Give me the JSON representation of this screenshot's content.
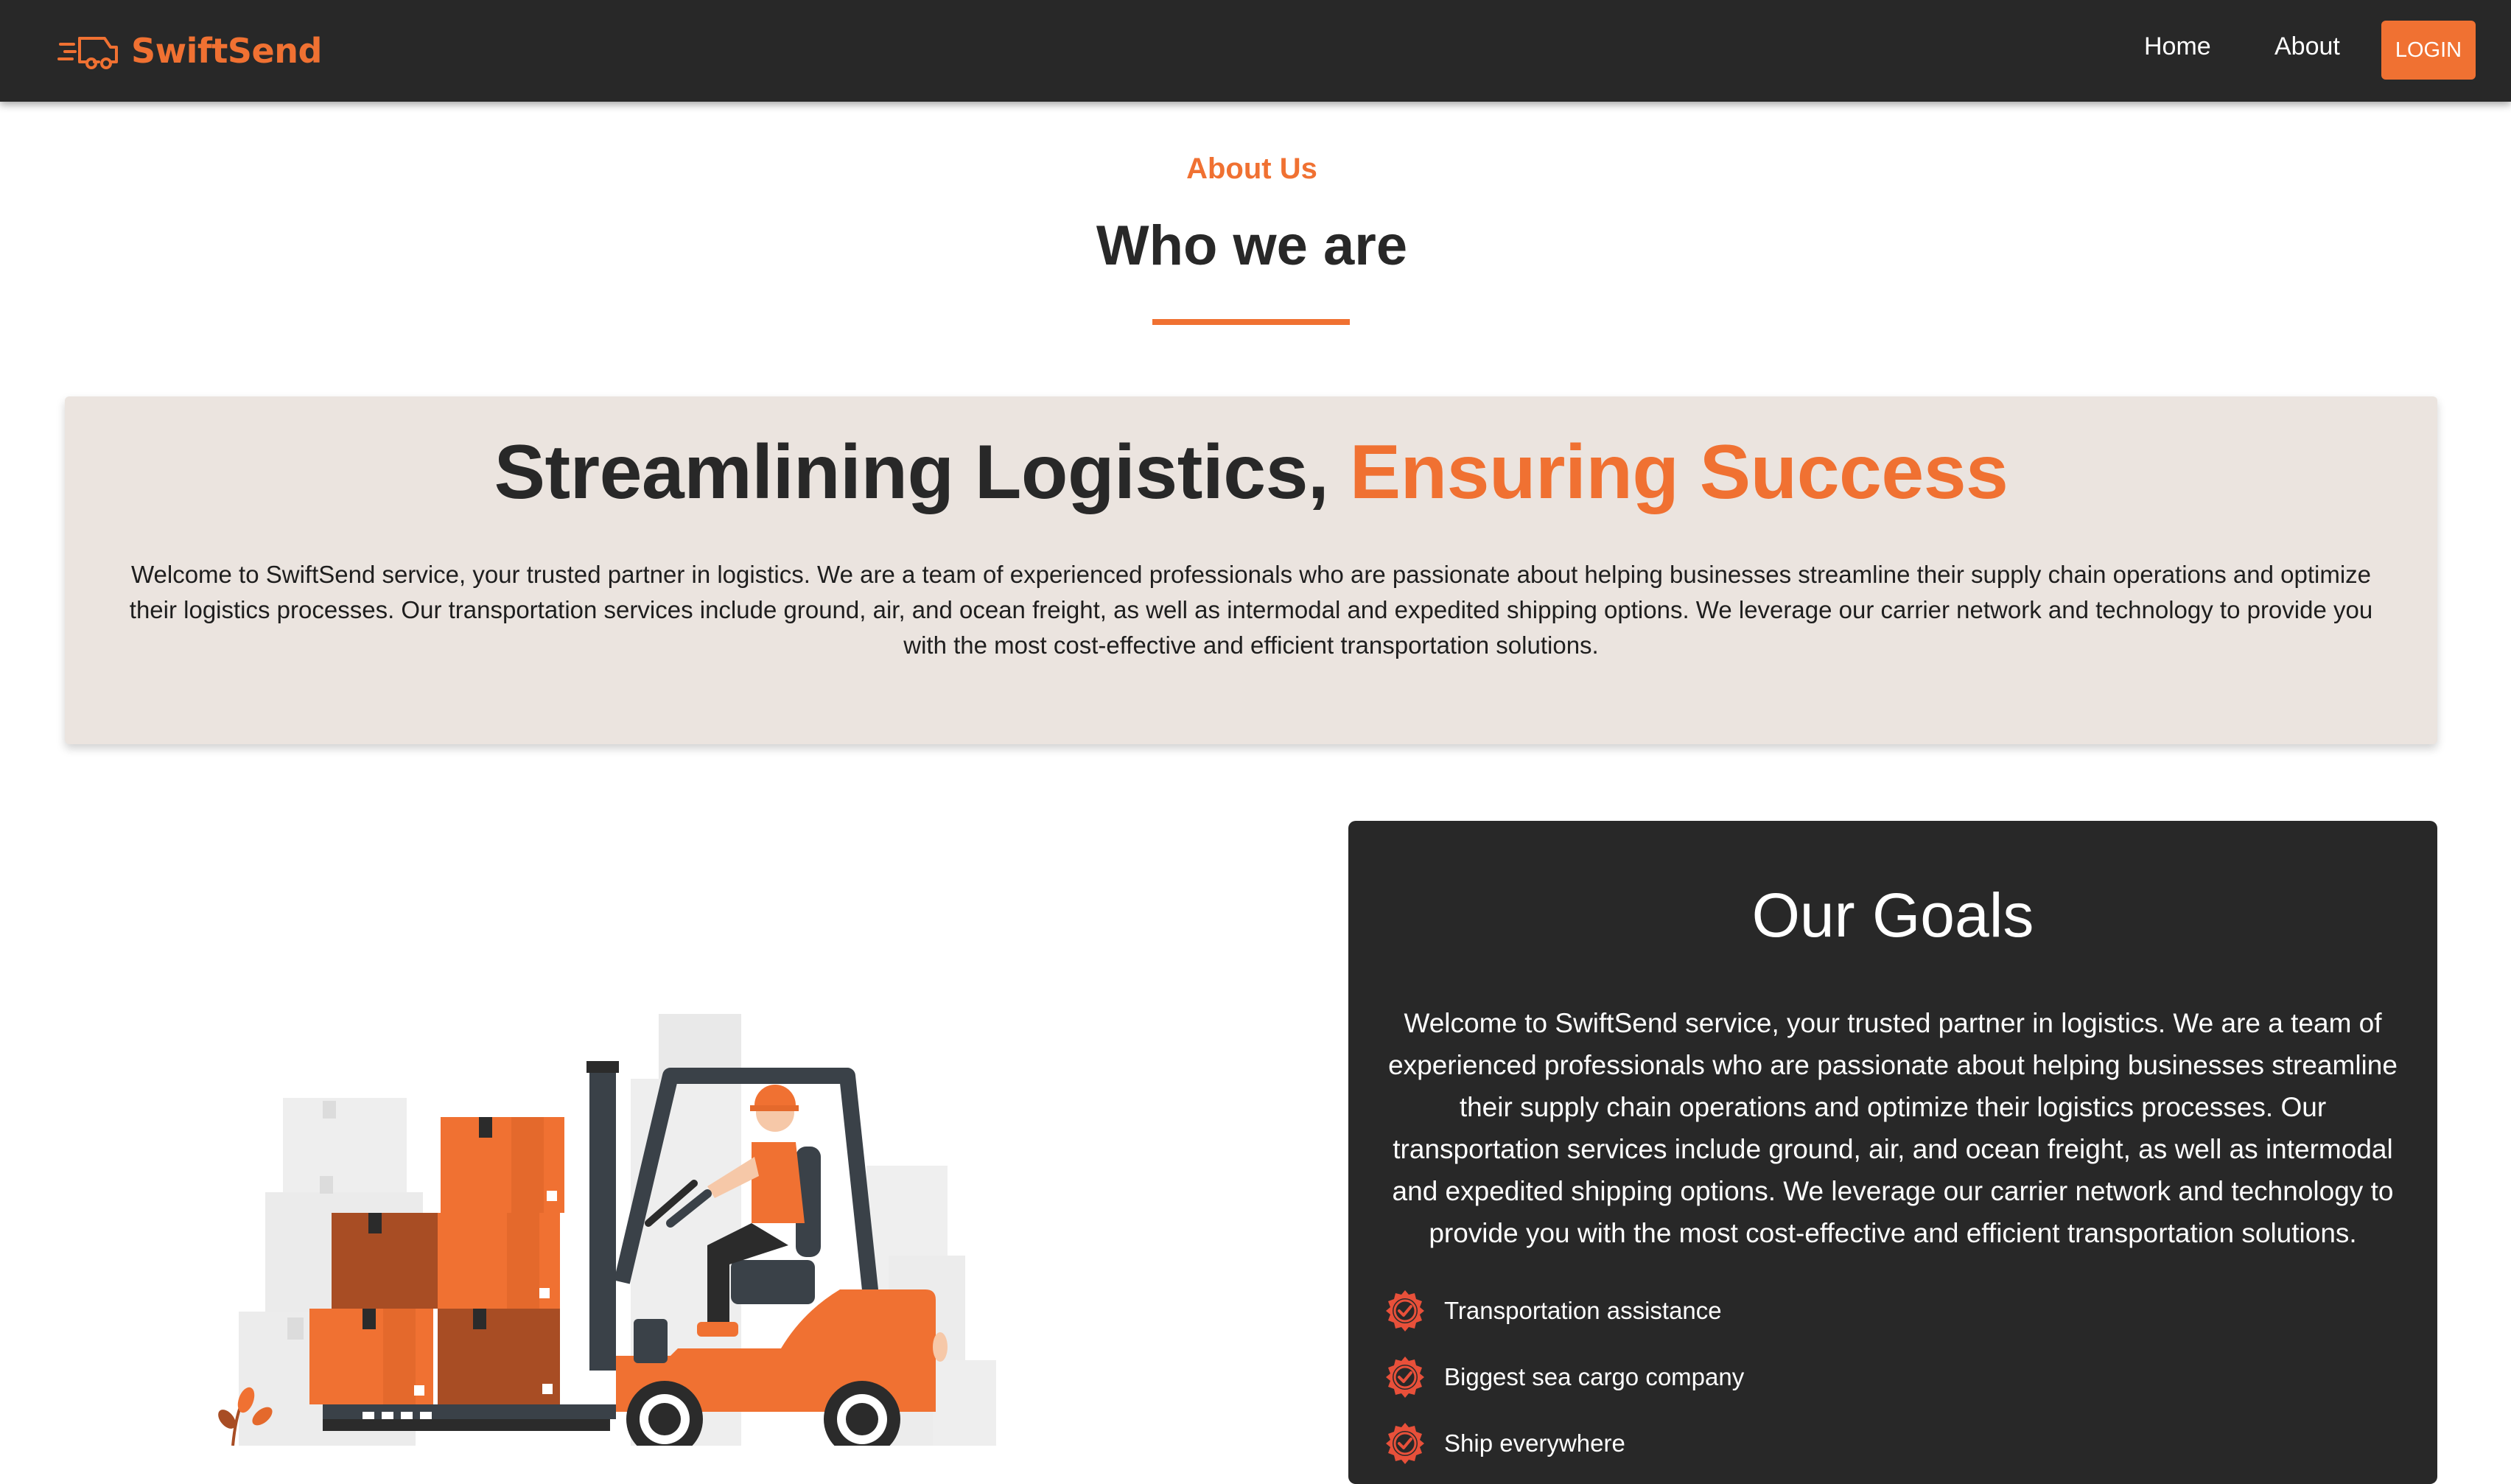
{
  "brand": {
    "name": "SwiftSend",
    "logo_icon": "delivery-truck-icon",
    "accent_color": "#f07132",
    "dark_color": "#282828"
  },
  "nav": {
    "home_label": "Home",
    "about_label": "About",
    "login_label": "LOGIN"
  },
  "section": {
    "eyebrow": "About Us",
    "title": "Who we are"
  },
  "hero": {
    "title_part1": "Streamlining Logistics,",
    "title_part2": "Ensuring Success",
    "body": "Welcome to SwiftSend service, your trusted partner in logistics. We are a team of experienced professionals who are passionate about helping businesses streamline their supply chain operations and optimize their logistics processes. Our transportation services include ground, air, and ocean freight, as well as intermodal and expedited shipping options. We leverage our carrier network and technology to provide you with the most cost-effective and efficient transportation solutions.",
    "background_color": "#ebe4df"
  },
  "illustration": {
    "subject": "forklift-with-boxes-illustration"
  },
  "goals": {
    "title": "Our Goals",
    "body": "Welcome to SwiftSend service, your trusted partner in logistics. We are a team of experienced professionals who are passionate about helping businesses streamline their supply chain operations and optimize their logistics processes. Our transportation services include ground, air, and ocean freight, as well as intermodal and expedited shipping options. We leverage our carrier network and technology to provide you with the most cost-effective and efficient transportation solutions.",
    "items": [
      {
        "label": "Transportation assistance",
        "icon": "check-badge-icon"
      },
      {
        "label": "Biggest sea cargo company",
        "icon": "check-badge-icon"
      },
      {
        "label": "Ship everywhere",
        "icon": "check-badge-icon"
      }
    ]
  }
}
